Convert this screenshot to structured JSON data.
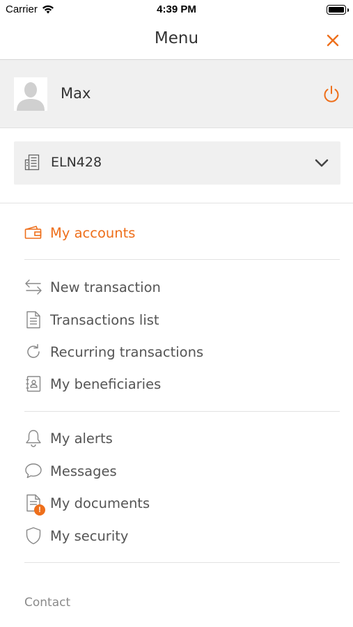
{
  "status_bar": {
    "carrier": "Carrier",
    "time": "4:39 PM"
  },
  "header": {
    "title": "Menu"
  },
  "profile": {
    "name": "Max"
  },
  "account": {
    "selected": "ELN428"
  },
  "menu": {
    "my_accounts": "My accounts",
    "transactions_group": [
      {
        "label": "New transaction",
        "icon": "transfer-arrows-icon"
      },
      {
        "label": "Transactions list",
        "icon": "document-list-icon"
      },
      {
        "label": "Recurring transactions",
        "icon": "refresh-icon"
      },
      {
        "label": "My beneficiaries",
        "icon": "contact-book-icon"
      }
    ],
    "personal_group": [
      {
        "label": "My alerts",
        "icon": "bell-icon"
      },
      {
        "label": "Messages",
        "icon": "chat-bubble-icon"
      },
      {
        "label": "My documents",
        "icon": "document-icon",
        "badge": "!"
      },
      {
        "label": "My security",
        "icon": "shield-icon"
      }
    ]
  },
  "footer": {
    "contact": "Contact"
  },
  "colors": {
    "accent": "#ee6f1b",
    "text": "#555555",
    "panel": "#f0f0f0",
    "divider": "#e2e2e2"
  }
}
